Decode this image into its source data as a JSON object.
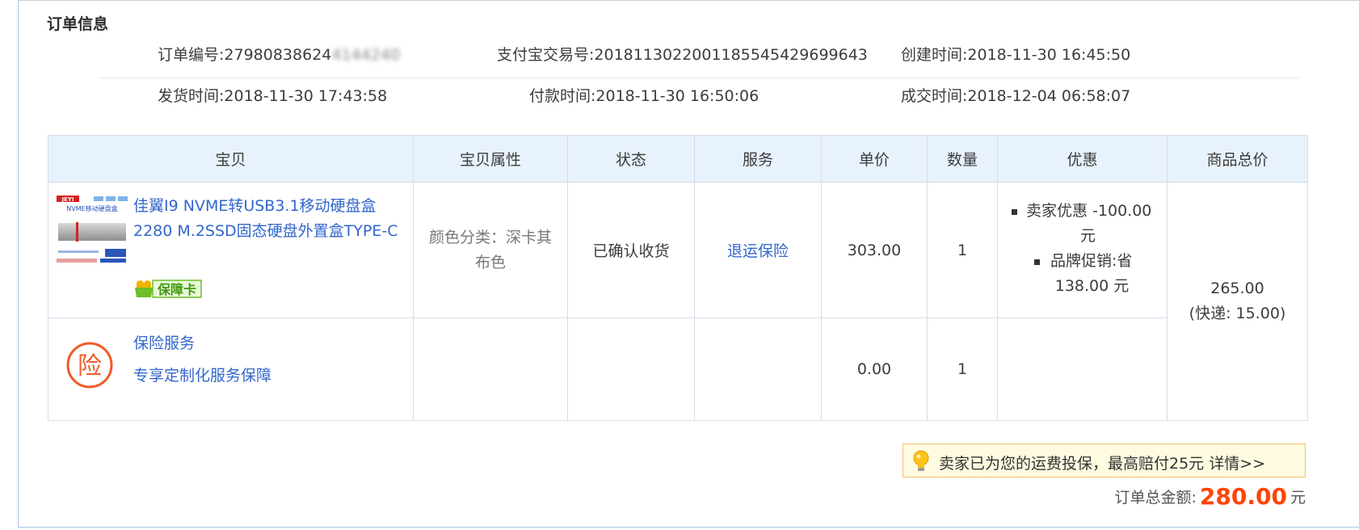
{
  "section_title": "订单信息",
  "order": {
    "order_no_label": "订单编号:",
    "order_no_visible": "27980838624",
    "order_no_masked": "4144240",
    "alipay_label": "支付宝交易号:",
    "alipay_no": "2018113022001185545429699643",
    "created_label": "创建时间:",
    "created_time": "2018-11-30 16:45:50",
    "shipped_label": "发货时间:",
    "shipped_time": "2018-11-30 17:43:58",
    "paid_label": "付款时间:",
    "paid_time": "2018-11-30 16:50:06",
    "closed_label": "成交时间:",
    "closed_time": "2018-12-04 06:58:07"
  },
  "table": {
    "headers": [
      "宝贝",
      "宝贝属性",
      "状态",
      "服务",
      "单价",
      "数量",
      "优惠",
      "商品总价"
    ],
    "item": {
      "thumb_brand": "JEYI",
      "thumb_caption": "NVME移动硬盘盒",
      "title": "佳翼I9 NVME转USB3.1移动硬盘盒2280 M.2SSD固态硬盘外置盒TYPE-C",
      "badge": "保障卡",
      "attribute": "颜色分类：深卡其布色",
      "status": "已确认收货",
      "service": "退运保险",
      "unit_price": "303.00",
      "quantity": "1",
      "promo1_label": "卖家优惠 -100.00",
      "promo1_unit": "元",
      "promo2_label": "品牌促销:省",
      "promo2_value": "138.00 元",
      "total_price": "265.00",
      "shipping": "(快递: 15.00)"
    },
    "insurance": {
      "icon_text": "险",
      "name": "保险服务",
      "desc": "专享定制化服务保障",
      "unit_price": "0.00",
      "quantity": "1"
    }
  },
  "notice": "卖家已为您的运费投保，最高赔付25元 详情>>",
  "total": {
    "label": "订单总金额:",
    "amount": "280.00",
    "unit": "元"
  },
  "colors": {
    "link": "#3366cc",
    "accent": "#ff4400",
    "header_bg": "#e8f2fd",
    "notice_bg": "#fffbe0"
  }
}
